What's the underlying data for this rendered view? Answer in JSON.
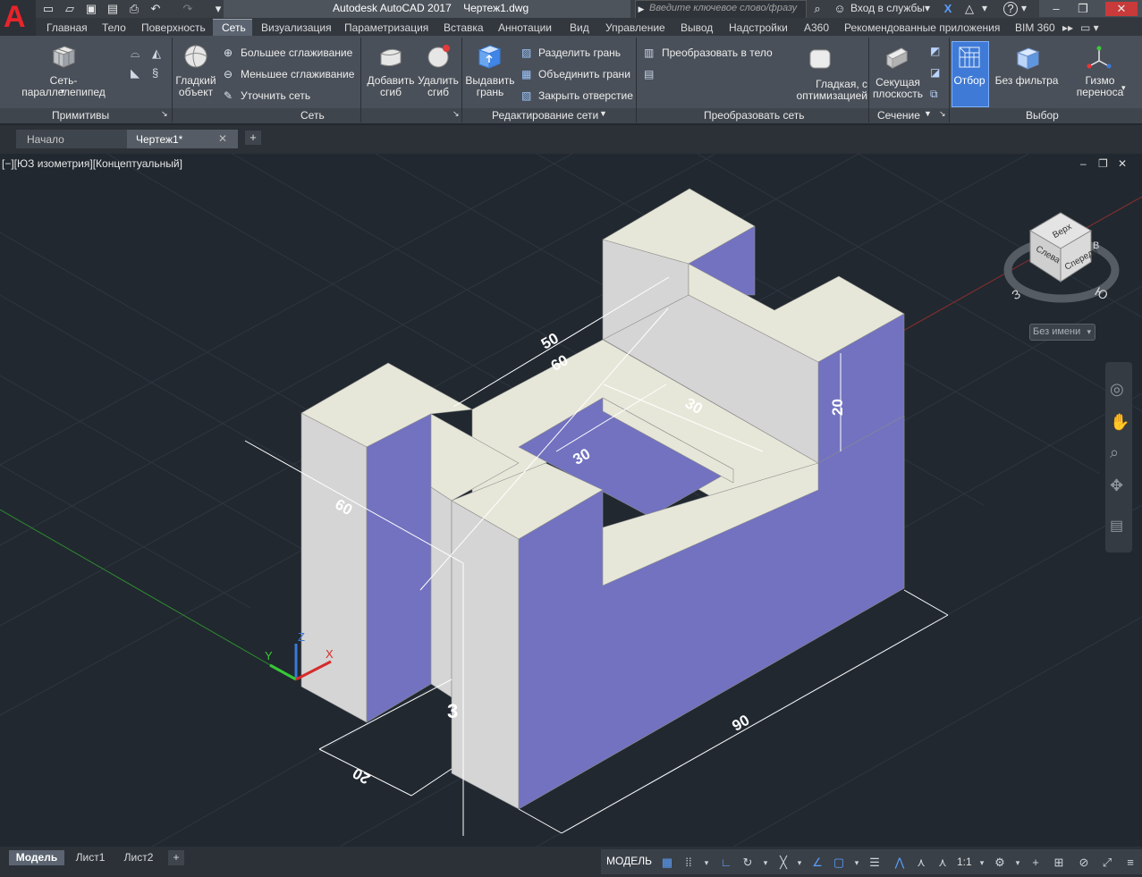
{
  "titlebar": {
    "app_title": "Autodesk AutoCAD 2017",
    "doc_title": "Чертеж1.dwg",
    "search_placeholder": "Введите ключевое слово/фразу",
    "signin": "Вход в службы",
    "help": "?"
  },
  "ribbon_tabs": [
    "Главная",
    "Тело",
    "Поверхность",
    "Сеть",
    "Визуализация",
    "Параметризация",
    "Вставка",
    "Аннотации",
    "Вид",
    "Управление",
    "Вывод",
    "Надстройки",
    "A360",
    "Рекомендованные приложения",
    "BIM 360"
  ],
  "active_tab": "Сеть",
  "ribbon": {
    "primitives": {
      "box_label": "Сеть-параллелепипед",
      "panel": "Примитивы"
    },
    "mesh": {
      "smooth_object": "Гладкий объект",
      "more_smooth": "Большее сглаживание",
      "less_smooth": "Меньшее сглаживание",
      "refine": "Уточнить сеть",
      "panel": "Сеть"
    },
    "edit": {
      "add_crease": "Добавить сгиб",
      "remove_crease": "Удалить сгиб",
      "extrude_face": "Выдавить грань",
      "split_face": "Разделить грань",
      "merge_faces": "Объединить грани",
      "close_hole": "Закрыть отверстие",
      "panel": "Редактирование сети"
    },
    "convert": {
      "to_solid": "Преобразовать в тело",
      "smooth_opt": "Гладкая, с оптимизацией",
      "panel": "Преобразовать сеть"
    },
    "section": {
      "plane": "Секущая плоскость",
      "panel": "Сечение"
    },
    "selection": {
      "culling": "Отбор",
      "no_filter": "Без фильтра",
      "gizmo": "Гизмо переноса",
      "panel": "Выбор"
    }
  },
  "doc_tabs": {
    "start": "Начало",
    "current": "Чертеж1*"
  },
  "viewport": {
    "label": "[−][ЮЗ изометрия][Концептуальный]",
    "viewcube": {
      "top": "Верх",
      "left": "Слева",
      "front": "Спереди",
      "west": "З",
      "south": "Ю",
      "east": "В",
      "named": "Без имени"
    },
    "dimensions": [
      "50",
      "60",
      "30",
      "30",
      "20",
      "60",
      "20",
      "90",
      "3"
    ]
  },
  "status": {
    "layout_tabs": [
      "Модель",
      "Лист1",
      "Лист2"
    ],
    "model_button": "МОДЕЛЬ",
    "scale": "1:1"
  },
  "colors": {
    "accent_blue": "#3f7ad6",
    "face_purple": "#7272c0",
    "face_light": "#d5d5d5",
    "face_top": "#e7e7d9",
    "bg": "#212830",
    "logo_red": "#e8242a"
  }
}
